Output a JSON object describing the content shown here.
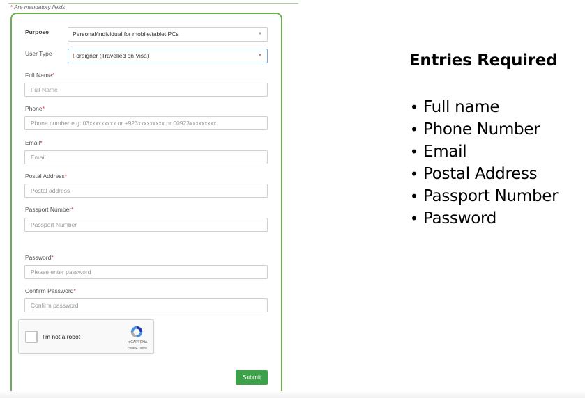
{
  "form": {
    "mandatory_note": "Are mandatory fields",
    "required_marker": "*",
    "purpose": {
      "label": "Purpose",
      "value": "Personal/individual for mobile/tablet PCs"
    },
    "user_type": {
      "label": "User Type",
      "value": "Foreigner (Travelled on Visa)"
    },
    "full_name": {
      "label": "Full Name",
      "placeholder": "Full Name"
    },
    "phone": {
      "label": "Phone",
      "placeholder": "Phone number e.g: 03xxxxxxxxx or +923xxxxxxxxx or 00923xxxxxxxxx."
    },
    "email": {
      "label": "Email",
      "placeholder": "Email"
    },
    "postal_address": {
      "label": "Postal Address",
      "placeholder": "Postal address"
    },
    "passport_number": {
      "label": "Passport Number",
      "placeholder": "Passport Number"
    },
    "password": {
      "label": "Password",
      "placeholder": "Please enter password"
    },
    "confirm_password": {
      "label": "Confirm Password",
      "placeholder": "Confirm password"
    },
    "captcha": {
      "label": "I'm not a robot",
      "brand": "reCAPTCHA",
      "terms": "Privacy - Terms"
    },
    "submit_label": "Submit"
  },
  "panel": {
    "title": "Entries Required",
    "bullet": "•",
    "items": [
      "Full name",
      "Phone Number",
      "Email",
      "Postal Address",
      "Passport Number",
      "Password"
    ]
  },
  "colors": {
    "form_border": "#6ab04c",
    "required": "#d9262c",
    "submit_bg": "#3da14a",
    "focus_border": "#7aa6d6"
  }
}
